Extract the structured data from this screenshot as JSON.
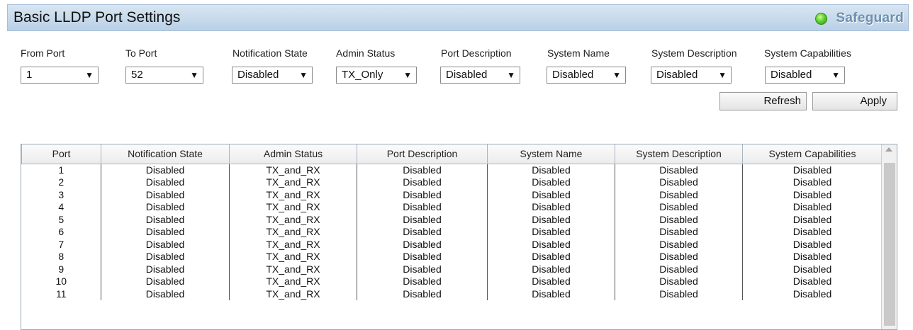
{
  "header": {
    "title": "Basic LLDP Port Settings",
    "safeguard_label": "Safeguard",
    "safeguard_led_color": "#5fd12c"
  },
  "filters": {
    "from_port": {
      "label": "From Port",
      "value": "1"
    },
    "to_port": {
      "label": "To Port",
      "value": "52"
    },
    "notification_state": {
      "label": "Notification State",
      "value": "Disabled"
    },
    "admin_status": {
      "label": "Admin Status",
      "value": "TX_Only"
    },
    "port_description": {
      "label": "Port Description",
      "value": "Disabled"
    },
    "system_name": {
      "label": "System Name",
      "value": "Disabled"
    },
    "system_description": {
      "label": "System Description",
      "value": "Disabled"
    },
    "system_capabilities": {
      "label": "System Capabilities",
      "value": "Disabled"
    }
  },
  "buttons": {
    "refresh": "Refresh",
    "apply": "Apply"
  },
  "table": {
    "columns": [
      "Port",
      "Notification State",
      "Admin Status",
      "Port Description",
      "System Name",
      "System Description",
      "System Capabilities"
    ],
    "rows": [
      [
        "1",
        "Disabled",
        "TX_and_RX",
        "Disabled",
        "Disabled",
        "Disabled",
        "Disabled"
      ],
      [
        "2",
        "Disabled",
        "TX_and_RX",
        "Disabled",
        "Disabled",
        "Disabled",
        "Disabled"
      ],
      [
        "3",
        "Disabled",
        "TX_and_RX",
        "Disabled",
        "Disabled",
        "Disabled",
        "Disabled"
      ],
      [
        "4",
        "Disabled",
        "TX_and_RX",
        "Disabled",
        "Disabled",
        "Disabled",
        "Disabled"
      ],
      [
        "5",
        "Disabled",
        "TX_and_RX",
        "Disabled",
        "Disabled",
        "Disabled",
        "Disabled"
      ],
      [
        "6",
        "Disabled",
        "TX_and_RX",
        "Disabled",
        "Disabled",
        "Disabled",
        "Disabled"
      ],
      [
        "7",
        "Disabled",
        "TX_and_RX",
        "Disabled",
        "Disabled",
        "Disabled",
        "Disabled"
      ],
      [
        "8",
        "Disabled",
        "TX_and_RX",
        "Disabled",
        "Disabled",
        "Disabled",
        "Disabled"
      ],
      [
        "9",
        "Disabled",
        "TX_and_RX",
        "Disabled",
        "Disabled",
        "Disabled",
        "Disabled"
      ],
      [
        "10",
        "Disabled",
        "TX_and_RX",
        "Disabled",
        "Disabled",
        "Disabled",
        "Disabled"
      ],
      [
        "11",
        "Disabled",
        "TX_and_RX",
        "Disabled",
        "Disabled",
        "Disabled",
        "Disabled"
      ]
    ]
  }
}
